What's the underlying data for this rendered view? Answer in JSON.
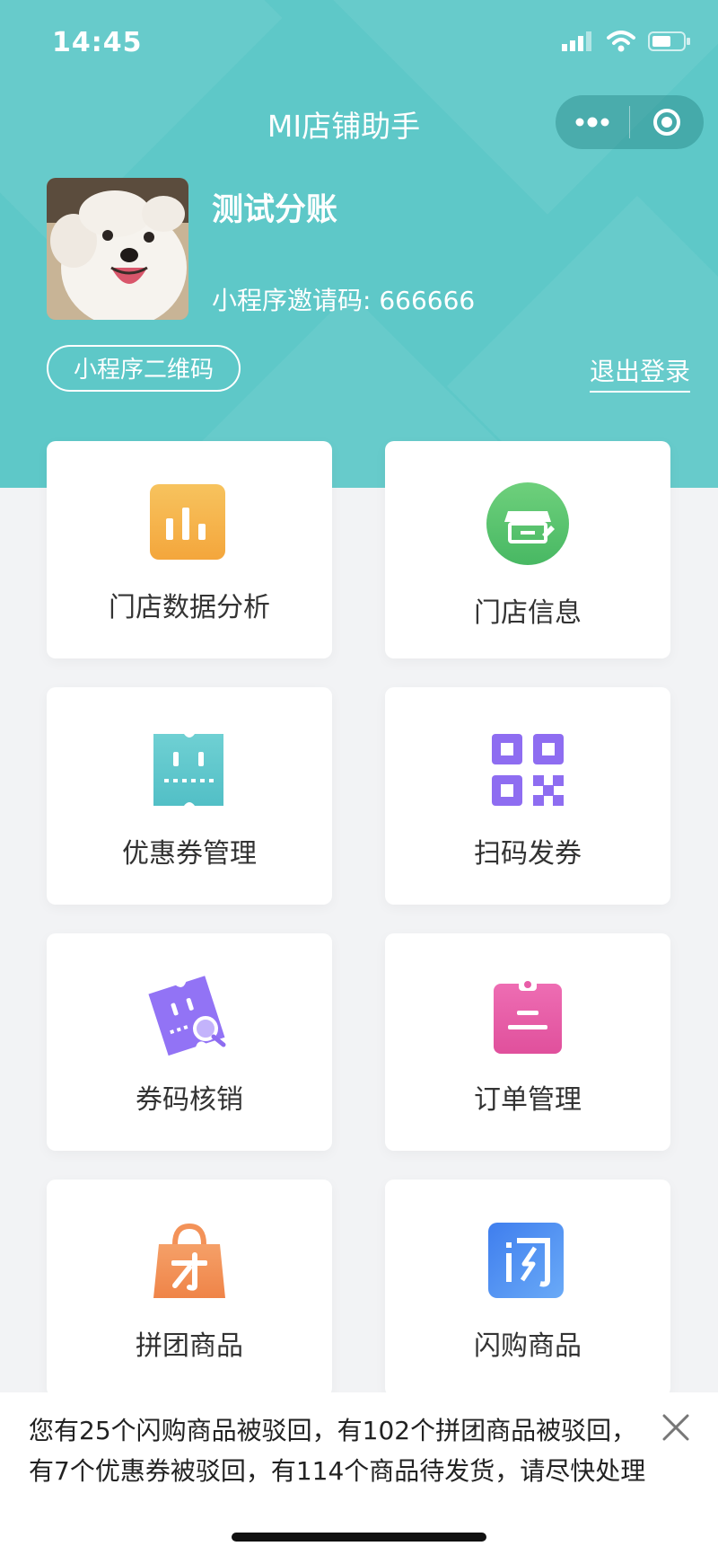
{
  "status_bar": {
    "time": "14:45"
  },
  "nav": {
    "title": "MI店铺助手"
  },
  "profile": {
    "store_name": "测试分账",
    "invite_label": "小程序邀请码: 666666",
    "qr_button": "小程序二维码",
    "logout": "退出登录"
  },
  "menu": [
    {
      "label": "门店数据分析",
      "icon": "bar-chart-icon",
      "color": "#f6b447"
    },
    {
      "label": "门店信息",
      "icon": "store-icon",
      "color": "#56c46d"
    },
    {
      "label": "优惠券管理",
      "icon": "coupon-icon",
      "color": "#62c9cf"
    },
    {
      "label": "扫码发券",
      "icon": "qr-code-icon",
      "color": "#8d6cf0"
    },
    {
      "label": "券码核销",
      "icon": "ticket-verify-icon",
      "color": "#8f6ff4"
    },
    {
      "label": "订单管理",
      "icon": "clipboard-icon",
      "color": "#e85da8"
    },
    {
      "label": "拼团商品",
      "icon": "shopping-bag-icon",
      "color": "#f39258"
    },
    {
      "label": "闪购商品",
      "icon": "flash-sale-icon",
      "color": "#4a8ff2"
    }
  ],
  "notice": {
    "text": "您有25个闪购商品被驳回，有102个拼团商品被驳回，有7个优惠券被驳回，有114个商品待发货，请尽快处理"
  }
}
